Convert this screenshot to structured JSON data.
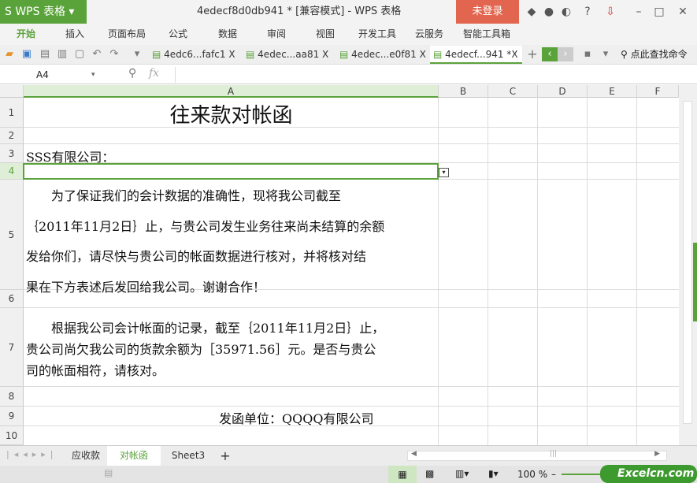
{
  "app": {
    "logo": "S WPS 表格",
    "title": "4edecf8d0db941 * [兼容模式] - WPS 表格",
    "login": "未登录"
  },
  "menu": [
    "开始",
    "插入",
    "页面布局",
    "公式",
    "数据",
    "审阅",
    "视图",
    "开发工具",
    "云服务",
    "智能工具箱"
  ],
  "doc_tabs": [
    {
      "label": "4edc6...fafc1",
      "close": "X"
    },
    {
      "label": "4edec...aa81",
      "close": "X"
    },
    {
      "label": "4edec...e0f81",
      "close": "X"
    },
    {
      "label": "4edecf...941 *",
      "close": "X"
    }
  ],
  "search_command": "点此查找命令",
  "formula": {
    "cell_ref": "A4",
    "fx": "fx",
    "value": ""
  },
  "columns": [
    "A",
    "B",
    "C",
    "D",
    "E",
    "F"
  ],
  "rows": [
    "1",
    "2",
    "3",
    "4",
    "5",
    "6",
    "7",
    "8",
    "9",
    "10"
  ],
  "cells": {
    "a1": "往来款对帐函",
    "a3": "SSS有限公司：",
    "a5": [
      "　　为了保证我们的会计数据的准确性，现将我公司截至",
      "｛2011年11月2日｝止，与贵公司发生业务往来尚未结算的余额",
      "发给你们，请尽快与贵公司的帐面数据进行核对，并将核对结",
      "果在下方表述后发回给我公司。谢谢合作！"
    ],
    "a7": [
      "　　根据我公司会计帐面的记录，截至｛2011年11月2日｝止，",
      "贵公司尚欠我公司的货款余额为［35971.56］元。是否与贵公",
      "司的帐面相符，请核对。"
    ],
    "a9": "发函单位：QQQQ有限公司"
  },
  "sheets": [
    "应收款",
    "对帐函",
    "Sheet3"
  ],
  "active_sheet": 1,
  "status": {
    "zoom": "100 %",
    "watermark": "Excelcn.com"
  },
  "colors": {
    "accent": "#5aa33b",
    "login": "#e2664f"
  }
}
